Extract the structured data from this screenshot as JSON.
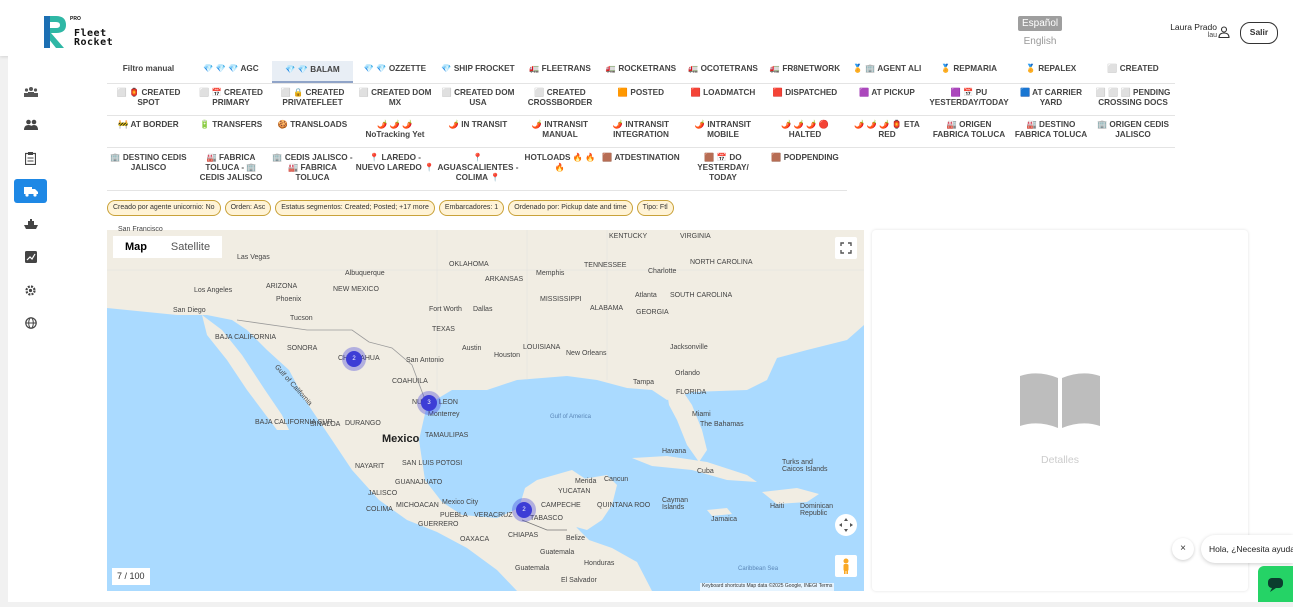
{
  "brand": {
    "pro": "PRO",
    "line1": "Fleet",
    "line2": "Rocket"
  },
  "header": {
    "lang_es": "Español",
    "lang_en": "English",
    "user_name": "Laura Prado",
    "user_short": "lau",
    "logout": "Salir"
  },
  "sidebar": {
    "items": [
      {
        "name": "sidebar-item-users-group",
        "icon": "group-icon"
      },
      {
        "name": "sidebar-item-people",
        "icon": "people-icon"
      },
      {
        "name": "sidebar-item-clipboard",
        "icon": "clipboard-icon"
      },
      {
        "name": "sidebar-item-trucks",
        "icon": "truck-icon",
        "active": true
      },
      {
        "name": "sidebar-item-ships",
        "icon": "ship-icon"
      },
      {
        "name": "sidebar-item-reports",
        "icon": "report-icon"
      },
      {
        "name": "sidebar-item-settings",
        "icon": "gear-icon"
      },
      {
        "name": "sidebar-item-globe",
        "icon": "globe-icon"
      }
    ]
  },
  "tabs": [
    "Filtro manual",
    "💎 💎 💎 AGC",
    "💎 💎 BALAM",
    "💎 💎 OZZETTE",
    "💎 SHIP FROCKET",
    "🚛 FLEETRANS",
    "🚛 ROCKETRANS",
    "🚛 OCOTETRANS",
    "🚛 FR8NETWORK",
    "🏅 🏢 AGENT ALI",
    "🏅 REPMARIA",
    "🏅 REPALEX",
    "⬜ CREATED",
    "⬜ 🏮 CREATED SPOT",
    "⬜ 📅 CREATED PRIMARY",
    "⬜ 🔒 CREATED PRIVATEFLEET",
    "⬜ CREATED DOM MX",
    "⬜ CREATED DOM USA",
    "⬜ CREATED CROSSBORDER",
    "🟧 POSTED",
    "🟥 LOADMATCH",
    "🟥 DISPATCHED",
    "🟪 AT PICKUP",
    "🟪 📅 PU YESTERDAY/TODAY",
    "🟦 AT CARRIER YARD",
    "⬜ ⬜ ⬜ PENDING CROSSING DOCS",
    "🚧 AT BORDER",
    "🔋 TRANSFERS",
    "🍪 TRANSLOADS",
    "🌶️ 🌶️ 🌶️ NoTracking Yet",
    "🌶️ IN TRANSIT",
    "🌶️ INTRANSIT MANUAL",
    "🌶️ INTRANSIT INTEGRATION",
    "🌶️ INTRANSIT MOBILE",
    "🌶️ 🌶️ 🌶️ 🔴 HALTED",
    "🌶️ 🌶️ 🌶️ 🏮 ETA RED",
    "🏭 ORIGEN FABRICA TOLUCA",
    "🏭 DESTINO FABRICA TOLUCA",
    "🏢 ORIGEN CEDIS JALISCO",
    "🏢 DESTINO CEDIS JALISCO",
    "🏭 FABRICA TOLUCA - 🏢 CEDIS JALISCO",
    "🏢 CEDIS JALISCO - 🏭 FABRICA TOLUCA",
    "📍 LAREDO - NUEVO LAREDO 📍",
    "📍 AGUASCALIENTES -COLIMA 📍",
    "HOTLOADS 🔥 🔥 🔥",
    "🟫 ATDESTINATION",
    "🟫 📅 DO YESTERDAY/ TODAY",
    "🟫 PODPENDING"
  ],
  "filters": [
    "Creado por agente unicornio: No",
    "Orden: Asc",
    "Estatus segmentos: Created; Posted; +17 more",
    "Embarcadores: 1",
    "Ordenado por: Pickup date and time",
    "Tipo: Ftl"
  ],
  "map": {
    "map_btn": "Map",
    "satellite_btn": "Satellite",
    "counter": "7 / 100",
    "attribution": "Keyboard shortcuts   Map data ©2025 Google, INEGI   Terms",
    "clusters": [
      "2",
      "3",
      "2"
    ],
    "labels": {
      "san_francisco": "San Francisco",
      "las_vegas": "Las Vegas",
      "los_angeles": "Los Angeles",
      "san_diego": "San Diego",
      "arizona": "ARIZONA",
      "phoenix": "Phoenix",
      "tucson": "Tucson",
      "baja_california": "BAJA CALIFORNIA",
      "albuquerque": "Albuquerque",
      "new_mexico": "NEW MEXICO",
      "oklahoma": "OKLAHOMA",
      "kentucky": "KENTUCKY",
      "virginia": "VIRGINIA",
      "tennessee": "TENNESSEE",
      "north_carolina": "NORTH CAROLINA",
      "charlotte": "Charlotte",
      "arkansas": "ARKANSAS",
      "memphis": "Memphis",
      "mississippi": "MISSISSIPPI",
      "atlanta": "Atlanta",
      "south_carolina": "SOUTH CAROLINA",
      "alabama": "ALABAMA",
      "georgia": "GEORGIA",
      "fort_worth": "Fort Worth",
      "dallas": "Dallas",
      "texas": "TEXAS",
      "austin": "Austin",
      "houston": "Houston",
      "san_antonio": "San Antonio",
      "louisiana": "LOUISIANA",
      "new_orleans": "New Orleans",
      "jacksonville": "Jacksonville",
      "orlando": "Orlando",
      "tampa": "Tampa",
      "florida": "FLORIDA",
      "miami": "Miami",
      "sonora": "SONORA",
      "chihuahua": "CHIHUAHUA",
      "coahuila": "COAHUILA",
      "nuevo_leon": "NUEVO LEON",
      "monterrey": "Monterrey",
      "gulf_california": "Gulf of California",
      "baja_california_sur": "BAJA CALIFORNIA SUR",
      "sinaloa": "SINALOA",
      "durango": "DURANGO",
      "tamaulipas": "TAMAULIPAS",
      "mexico": "Mexico",
      "gulf_mexico": "Gulf of America",
      "nayarit": "NAYARIT",
      "san_luis_potosi": "SAN LUIS POTOSI",
      "guanajuato": "GUANAJUATO",
      "jalisco": "JALISCO",
      "colima": "COLIMA",
      "michoacan": "MICHOACAN",
      "mexico_city": "Mexico City",
      "puebla": "PUEBLA",
      "veracruz": "VERACRUZ",
      "guerrero": "GUERRERO",
      "oaxaca": "OAXACA",
      "chiapas": "CHIAPAS",
      "tabasco": "TABASCO",
      "campeche": "CAMPECHE",
      "yucatan": "YUCATAN",
      "merida": "Merida",
      "cancun": "Cancun",
      "quintana_roo": "QUINTANA ROO",
      "belize": "Belize",
      "guatemala": "Guatemala",
      "guatemala_city": "Guatemala",
      "honduras": "Honduras",
      "el_salvador": "El Salvador",
      "havana": "Havana",
      "cuba": "Cuba",
      "the_bahamas": "The Bahamas",
      "turks_caicos": "Turks and Caicos Islands",
      "cayman": "Cayman Islands",
      "jamaica": "Jamaica",
      "haiti": "Haiti",
      "dominican": "Dominican Republic",
      "caribbean": "Caribbean Sea"
    }
  },
  "details": {
    "label": "Detalles"
  },
  "chat": {
    "close": "×",
    "bubble": "Hola, ¿Necesita ayuda?"
  },
  "colors": {
    "accent": "#1e88e5",
    "cluster": "#3d3dd6",
    "chat": "#25d366",
    "chip_border": "#c9a23a",
    "chip_bg": "#fff3d6"
  }
}
